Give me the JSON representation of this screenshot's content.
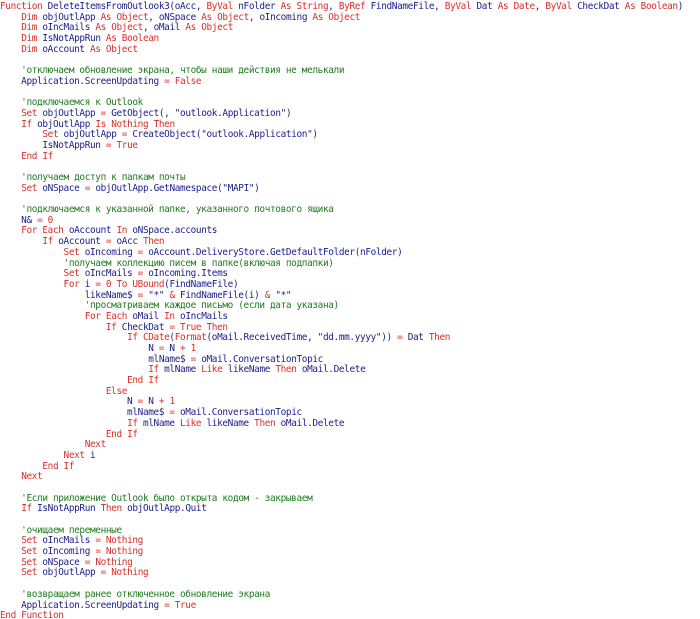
{
  "colors": {
    "background": "#ffffff",
    "keyword": "#d82e2a",
    "text": "#1c1c8a",
    "comment": "#1f7a1f",
    "string": "#1c1c8a",
    "number": "#d82e2a",
    "operator": "#d82e2a"
  },
  "lines": [
    [
      {
        "t": "k",
        "v": "Function "
      },
      {
        "t": "t",
        "v": "DeleteItemsFromOutlook3(oAcc, "
      },
      {
        "t": "k",
        "v": "ByVal "
      },
      {
        "t": "t",
        "v": "nFolder "
      },
      {
        "t": "k",
        "v": "As String"
      },
      {
        "t": "t",
        "v": ", "
      },
      {
        "t": "k",
        "v": "ByRef "
      },
      {
        "t": "t",
        "v": "FindNameFile, "
      },
      {
        "t": "k",
        "v": "ByVal "
      },
      {
        "t": "t",
        "v": "Dat "
      },
      {
        "t": "k",
        "v": "As Date"
      },
      {
        "t": "t",
        "v": ", "
      },
      {
        "t": "k",
        "v": "ByVal "
      },
      {
        "t": "t",
        "v": "CheckDat "
      },
      {
        "t": "k",
        "v": "As Boolean"
      },
      {
        "t": "t",
        "v": ")"
      }
    ],
    [
      {
        "t": "t",
        "v": "    "
      },
      {
        "t": "k",
        "v": "Dim "
      },
      {
        "t": "t",
        "v": "objOutlApp "
      },
      {
        "t": "k",
        "v": "As Object"
      },
      {
        "t": "t",
        "v": ", oNSpace "
      },
      {
        "t": "k",
        "v": "As Object"
      },
      {
        "t": "t",
        "v": ", oIncoming "
      },
      {
        "t": "k",
        "v": "As Object"
      }
    ],
    [
      {
        "t": "t",
        "v": "    "
      },
      {
        "t": "k",
        "v": "Dim "
      },
      {
        "t": "t",
        "v": "oIncMails "
      },
      {
        "t": "k",
        "v": "As Object"
      },
      {
        "t": "t",
        "v": ", oMail "
      },
      {
        "t": "k",
        "v": "As Object"
      }
    ],
    [
      {
        "t": "t",
        "v": "    "
      },
      {
        "t": "k",
        "v": "Dim "
      },
      {
        "t": "t",
        "v": "IsNotAppRun "
      },
      {
        "t": "k",
        "v": "As Boolean"
      }
    ],
    [
      {
        "t": "t",
        "v": "    "
      },
      {
        "t": "k",
        "v": "Dim "
      },
      {
        "t": "t",
        "v": "oAccount "
      },
      {
        "t": "k",
        "v": "As Object"
      }
    ],
    [
      {
        "t": "t",
        "v": ""
      }
    ],
    [
      {
        "t": "c",
        "v": "    'отключаем обновление экрана, чтобы наши действия не мелькали"
      }
    ],
    [
      {
        "t": "t",
        "v": "    Application.ScreenUpdating "
      },
      {
        "t": "o",
        "v": "= "
      },
      {
        "t": "k",
        "v": "False"
      }
    ],
    [
      {
        "t": "t",
        "v": ""
      }
    ],
    [
      {
        "t": "c",
        "v": "    'подключаемся к Outlook"
      }
    ],
    [
      {
        "t": "t",
        "v": "    "
      },
      {
        "t": "k",
        "v": "Set "
      },
      {
        "t": "t",
        "v": "objOutlApp "
      },
      {
        "t": "o",
        "v": "= "
      },
      {
        "t": "t",
        "v": "GetObject(, "
      },
      {
        "t": "s",
        "v": "\"outlook.Application\""
      },
      {
        "t": "t",
        "v": ")"
      }
    ],
    [
      {
        "t": "t",
        "v": "    "
      },
      {
        "t": "k",
        "v": "If "
      },
      {
        "t": "t",
        "v": "objOutlApp "
      },
      {
        "t": "k",
        "v": "Is Nothing Then"
      }
    ],
    [
      {
        "t": "t",
        "v": "        "
      },
      {
        "t": "k",
        "v": "Set "
      },
      {
        "t": "t",
        "v": "objOutlApp "
      },
      {
        "t": "o",
        "v": "= "
      },
      {
        "t": "t",
        "v": "CreateObject("
      },
      {
        "t": "s",
        "v": "\"outlook.Application\""
      },
      {
        "t": "t",
        "v": ")"
      }
    ],
    [
      {
        "t": "t",
        "v": "        IsNotAppRun "
      },
      {
        "t": "o",
        "v": "= "
      },
      {
        "t": "k",
        "v": "True"
      }
    ],
    [
      {
        "t": "t",
        "v": "    "
      },
      {
        "t": "k",
        "v": "End If"
      }
    ],
    [
      {
        "t": "t",
        "v": ""
      }
    ],
    [
      {
        "t": "c",
        "v": "    'получаем доступ к папкам почты"
      }
    ],
    [
      {
        "t": "t",
        "v": "    "
      },
      {
        "t": "k",
        "v": "Set "
      },
      {
        "t": "t",
        "v": "oNSpace "
      },
      {
        "t": "o",
        "v": "= "
      },
      {
        "t": "t",
        "v": "objOutlApp.GetNamespace("
      },
      {
        "t": "s",
        "v": "\"MAPI\""
      },
      {
        "t": "t",
        "v": ")"
      }
    ],
    [
      {
        "t": "t",
        "v": ""
      }
    ],
    [
      {
        "t": "c",
        "v": "    'подключаемся к указанной папке, указанного почтового ящика"
      }
    ],
    [
      {
        "t": "t",
        "v": "    N& "
      },
      {
        "t": "o",
        "v": "= "
      },
      {
        "t": "n",
        "v": "0"
      }
    ],
    [
      {
        "t": "t",
        "v": "    "
      },
      {
        "t": "k",
        "v": "For Each "
      },
      {
        "t": "t",
        "v": "oAccount "
      },
      {
        "t": "k",
        "v": "In "
      },
      {
        "t": "t",
        "v": "oNSpace.accounts"
      }
    ],
    [
      {
        "t": "t",
        "v": "        "
      },
      {
        "t": "k",
        "v": "If "
      },
      {
        "t": "t",
        "v": "oAccount "
      },
      {
        "t": "o",
        "v": "= "
      },
      {
        "t": "t",
        "v": "oAcc "
      },
      {
        "t": "k",
        "v": "Then"
      }
    ],
    [
      {
        "t": "t",
        "v": "            "
      },
      {
        "t": "k",
        "v": "Set "
      },
      {
        "t": "t",
        "v": "oIncoming "
      },
      {
        "t": "o",
        "v": "= "
      },
      {
        "t": "t",
        "v": "oAccount.DeliveryStore.GetDefaultFolder(nFolder)"
      }
    ],
    [
      {
        "t": "c",
        "v": "            'получаем коллекцию писем в папке(включая подпапки)"
      }
    ],
    [
      {
        "t": "t",
        "v": "            "
      },
      {
        "t": "k",
        "v": "Set "
      },
      {
        "t": "t",
        "v": "oIncMails "
      },
      {
        "t": "o",
        "v": "= "
      },
      {
        "t": "t",
        "v": "oIncoming.Items"
      }
    ],
    [
      {
        "t": "t",
        "v": "            "
      },
      {
        "t": "k",
        "v": "For "
      },
      {
        "t": "t",
        "v": "i "
      },
      {
        "t": "o",
        "v": "= "
      },
      {
        "t": "n",
        "v": "0 "
      },
      {
        "t": "k",
        "v": "To UBound"
      },
      {
        "t": "t",
        "v": "(FindNameFile)"
      }
    ],
    [
      {
        "t": "t",
        "v": "                likeName$ "
      },
      {
        "t": "o",
        "v": "= "
      },
      {
        "t": "s",
        "v": "\"*\" "
      },
      {
        "t": "o",
        "v": "& "
      },
      {
        "t": "t",
        "v": "FindNameFile(i) "
      },
      {
        "t": "o",
        "v": "& "
      },
      {
        "t": "s",
        "v": "\"*\""
      }
    ],
    [
      {
        "t": "c",
        "v": "                'просматриваем каждое письмо (если дата указана)"
      }
    ],
    [
      {
        "t": "t",
        "v": "                "
      },
      {
        "t": "k",
        "v": "For Each "
      },
      {
        "t": "t",
        "v": "oMail "
      },
      {
        "t": "k",
        "v": "In "
      },
      {
        "t": "t",
        "v": "oIncMails"
      }
    ],
    [
      {
        "t": "t",
        "v": "                    "
      },
      {
        "t": "k",
        "v": "If "
      },
      {
        "t": "t",
        "v": "CheckDat "
      },
      {
        "t": "o",
        "v": "= "
      },
      {
        "t": "k",
        "v": "True Then"
      }
    ],
    [
      {
        "t": "t",
        "v": "                        "
      },
      {
        "t": "k",
        "v": "If CDate"
      },
      {
        "t": "t",
        "v": "("
      },
      {
        "t": "k",
        "v": "Format"
      },
      {
        "t": "t",
        "v": "(oMail.ReceivedTime, "
      },
      {
        "t": "s",
        "v": "\"dd.mm.yyyy\""
      },
      {
        "t": "t",
        "v": ")) "
      },
      {
        "t": "o",
        "v": "= "
      },
      {
        "t": "t",
        "v": "Dat "
      },
      {
        "t": "k",
        "v": "Then"
      }
    ],
    [
      {
        "t": "t",
        "v": "                            N "
      },
      {
        "t": "o",
        "v": "= "
      },
      {
        "t": "t",
        "v": "N "
      },
      {
        "t": "o",
        "v": "+ "
      },
      {
        "t": "n",
        "v": "1"
      }
    ],
    [
      {
        "t": "t",
        "v": "                            mlName$ "
      },
      {
        "t": "o",
        "v": "= "
      },
      {
        "t": "t",
        "v": "oMail.ConversationTopic"
      }
    ],
    [
      {
        "t": "t",
        "v": "                            "
      },
      {
        "t": "k",
        "v": "If "
      },
      {
        "t": "t",
        "v": "mlName "
      },
      {
        "t": "k",
        "v": "Like "
      },
      {
        "t": "t",
        "v": "likeName "
      },
      {
        "t": "k",
        "v": "Then "
      },
      {
        "t": "t",
        "v": "oMail.Delete"
      }
    ],
    [
      {
        "t": "t",
        "v": "                        "
      },
      {
        "t": "k",
        "v": "End If"
      }
    ],
    [
      {
        "t": "t",
        "v": "                    "
      },
      {
        "t": "k",
        "v": "Else"
      }
    ],
    [
      {
        "t": "t",
        "v": "                        N "
      },
      {
        "t": "o",
        "v": "= "
      },
      {
        "t": "t",
        "v": "N "
      },
      {
        "t": "o",
        "v": "+ "
      },
      {
        "t": "n",
        "v": "1"
      }
    ],
    [
      {
        "t": "t",
        "v": "                        mlName$ "
      },
      {
        "t": "o",
        "v": "= "
      },
      {
        "t": "t",
        "v": "oMail.ConversationTopic"
      }
    ],
    [
      {
        "t": "t",
        "v": "                        "
      },
      {
        "t": "k",
        "v": "If "
      },
      {
        "t": "t",
        "v": "mlName "
      },
      {
        "t": "k",
        "v": "Like "
      },
      {
        "t": "t",
        "v": "likeName "
      },
      {
        "t": "k",
        "v": "Then "
      },
      {
        "t": "t",
        "v": "oMail.Delete"
      }
    ],
    [
      {
        "t": "t",
        "v": "                    "
      },
      {
        "t": "k",
        "v": "End If"
      }
    ],
    [
      {
        "t": "t",
        "v": "                "
      },
      {
        "t": "k",
        "v": "Next"
      }
    ],
    [
      {
        "t": "t",
        "v": "            "
      },
      {
        "t": "k",
        "v": "Next "
      },
      {
        "t": "t",
        "v": "i"
      }
    ],
    [
      {
        "t": "t",
        "v": "        "
      },
      {
        "t": "k",
        "v": "End If"
      }
    ],
    [
      {
        "t": "t",
        "v": "    "
      },
      {
        "t": "k",
        "v": "Next"
      }
    ],
    [
      {
        "t": "t",
        "v": ""
      }
    ],
    [
      {
        "t": "c",
        "v": "    'Если приложение Outlook было открыта кодом - закрываем"
      }
    ],
    [
      {
        "t": "t",
        "v": "    "
      },
      {
        "t": "k",
        "v": "If "
      },
      {
        "t": "t",
        "v": "IsNotAppRun "
      },
      {
        "t": "k",
        "v": "Then "
      },
      {
        "t": "t",
        "v": "objOutlApp.Quit"
      }
    ],
    [
      {
        "t": "t",
        "v": ""
      }
    ],
    [
      {
        "t": "c",
        "v": "    'очищаем переменные"
      }
    ],
    [
      {
        "t": "t",
        "v": "    "
      },
      {
        "t": "k",
        "v": "Set "
      },
      {
        "t": "t",
        "v": "oIncMails "
      },
      {
        "t": "o",
        "v": "= "
      },
      {
        "t": "k",
        "v": "Nothing"
      }
    ],
    [
      {
        "t": "t",
        "v": "    "
      },
      {
        "t": "k",
        "v": "Set "
      },
      {
        "t": "t",
        "v": "oIncoming "
      },
      {
        "t": "o",
        "v": "= "
      },
      {
        "t": "k",
        "v": "Nothing"
      }
    ],
    [
      {
        "t": "t",
        "v": "    "
      },
      {
        "t": "k",
        "v": "Set "
      },
      {
        "t": "t",
        "v": "oNSpace "
      },
      {
        "t": "o",
        "v": "= "
      },
      {
        "t": "k",
        "v": "Nothing"
      }
    ],
    [
      {
        "t": "t",
        "v": "    "
      },
      {
        "t": "k",
        "v": "Set "
      },
      {
        "t": "t",
        "v": "objOutlApp "
      },
      {
        "t": "o",
        "v": "= "
      },
      {
        "t": "k",
        "v": "Nothing"
      }
    ],
    [
      {
        "t": "t",
        "v": ""
      }
    ],
    [
      {
        "t": "c",
        "v": "    'возвращаем ранее отключенное обновление экрана"
      }
    ],
    [
      {
        "t": "t",
        "v": "    Application.ScreenUpdating "
      },
      {
        "t": "o",
        "v": "= "
      },
      {
        "t": "k",
        "v": "True"
      }
    ],
    [
      {
        "t": "k",
        "v": "End Function"
      }
    ]
  ]
}
